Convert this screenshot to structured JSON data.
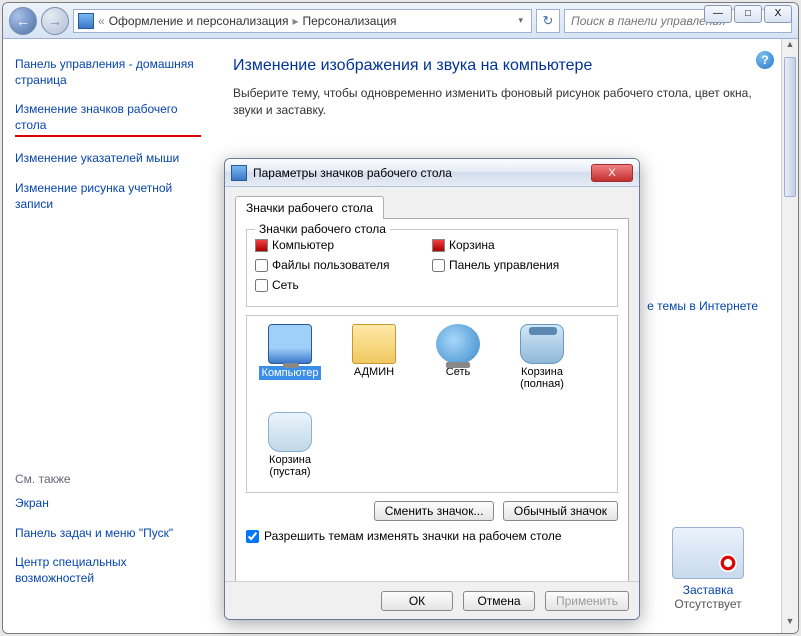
{
  "window": {
    "minimize": "—",
    "maximize": "□",
    "close": "X"
  },
  "toolbar": {
    "back": "←",
    "forward": "→",
    "breadcrumb1": "Оформление и персонализация",
    "breadcrumb2": "Персонализация",
    "sep": "▸",
    "dropdown": "▾",
    "refresh": "↻",
    "search_placeholder": "Поиск в панели управления"
  },
  "sidebar": {
    "items": [
      "Панель управления - домашняя страница",
      "Изменение значков рабочего стола",
      "Изменение указателей мыши",
      "Изменение рисунка учетной записи"
    ],
    "seealso_label": "См. также",
    "seealso": [
      "Экран",
      "Панель задач и меню \"Пуск\"",
      "Центр специальных возможностей"
    ]
  },
  "main": {
    "title": "Изменение изображения и звука на компьютере",
    "desc": "Выберите тему, чтобы одновременно изменить фоновый рисунок рабочего стола, цвет окна, звуки и заставку.",
    "online_link": "е темы в Интернете",
    "tile_label": "Заставка",
    "tile_value": "Отсутствует",
    "help": "?"
  },
  "dialog": {
    "title": "Параметры значков рабочего стола",
    "close": "X",
    "tab": "Значки рабочего стола",
    "group_legend": "Значки рабочего стола",
    "checks": {
      "computer": "Компьютер",
      "recycle": "Корзина",
      "userfiles": "Файлы пользователя",
      "cpanel": "Панель управления",
      "network": "Сеть"
    },
    "icons": [
      {
        "label": "Компьютер"
      },
      {
        "label": "АДМИН"
      },
      {
        "label": "Сеть"
      },
      {
        "label": "Корзина (полная)"
      },
      {
        "label": "Корзина (пустая)"
      }
    ],
    "change_icon": "Сменить значок...",
    "default_icon": "Обычный значок",
    "allow_themes": "Разрешить темам изменять значки на рабочем столе",
    "ok": "ОК",
    "cancel": "Отмена",
    "apply": "Применить"
  }
}
